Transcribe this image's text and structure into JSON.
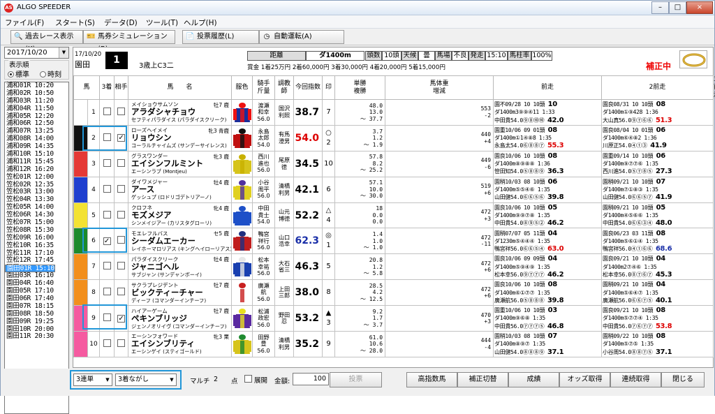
{
  "app": {
    "title": "ALGO SPEEDER",
    "logo_text": "AS"
  },
  "window_controls": {
    "min": "–",
    "max": "□",
    "close": "×"
  },
  "menu": [
    {
      "label": "ファイル(F)"
    },
    {
      "label": "スタート(S)"
    },
    {
      "label": "データ(D)"
    },
    {
      "label": "ツール(T)"
    },
    {
      "label": "ヘルプ(H)"
    }
  ],
  "toolbar": [
    {
      "label": "過去レース表示(K)",
      "icon": "search-icon",
      "glyph": "🔍"
    },
    {
      "label": "馬券シミュレーション(B)",
      "icon": "ticket-icon",
      "glyph": "🎫"
    },
    {
      "label": "投票履歴(L)",
      "icon": "document-icon",
      "glyph": "📄"
    },
    {
      "label": "自動運転(A)",
      "icon": "clock-icon",
      "glyph": "◷"
    }
  ],
  "sidebar": {
    "date": "2017/10/20",
    "order_label": "表示順",
    "order_opts": [
      "標準",
      "時刻"
    ],
    "order_selected": 0,
    "races": [
      "浦和01R 10:20",
      "浦和02R 10:50",
      "浦和03R 11:20",
      "浦和04R 11:50",
      "浦和05R 12:20",
      "浦和06R 12:50",
      "浦和07R 13:25",
      "浦和08R 14:00",
      "浦和09R 14:35",
      "浦和10R 15:10",
      "浦和11R 15:45",
      "浦和12R 16:20",
      "笠松01R 12:00",
      "笠松02R 12:35",
      "笠松03R 13:00",
      "笠松04R 13:30",
      "笠松05R 14:00",
      "笠松06R 14:30",
      "笠松07R 15:00",
      "笠松08R 15:30",
      "笠松09R 16:00",
      "笠松10R 16:35",
      "笠松11R 17:10",
      "笠松12R 17:45",
      "園田01R 15:10",
      "園田02R 15:40",
      "園田03R 16:10",
      "園田04R 16:40",
      "園田05R 17:10",
      "園田06R 17:40",
      "園田07R 18:15",
      "園田08R 18:50",
      "園田09R 19:25",
      "園田10R 20:00",
      "園田11R 20:30"
    ],
    "selected_race": 24
  },
  "race": {
    "date": "17/10/20",
    "venue": "園田",
    "number": "1",
    "class": "3歳上C3二",
    "dist_label": "距離",
    "dist": "ダ1400m",
    "heads_label": "頭数",
    "heads": "10頭",
    "weather_label": "天候",
    "weather": "曇",
    "track_label": "馬場",
    "track": "不良",
    "post_label": "発走",
    "post": "15:10",
    "horse_rate_label": "馬柱率",
    "horse_rate": "100%",
    "prize": "賞金 1着25万円 2着60,000円 3着30,000円 4着20,000円 5着15,000円",
    "hosei": "補正中"
  },
  "columns": [
    "馬",
    "3着",
    "相手",
    "馬　　名",
    "服色",
    "騎手\n斤量",
    "調教\n師",
    "今回指数",
    "印",
    "単勝\n複勝",
    "馬体重\n増減",
    "前走",
    "2前走",
    "3前走"
  ],
  "waku_colors": [
    "#ffffff",
    "#111111",
    "#e53935",
    "#1e3fcf",
    "#f3e233",
    "#1c8a2c",
    "#f28f1c",
    "#f55aa0"
  ],
  "horses": [
    {
      "waku": 1,
      "no": "1",
      "c3": false,
      "ai": false,
      "kana": "メイショウサムソン",
      "name": "アラダシャチョウ",
      "sire": "セフティパラダイス (パラダイスクリーク)",
      "tr": "牡7 鹿",
      "silk": [
        "#1a2d9a",
        "#e11",
        "#e11"
      ],
      "jockey": [
        "渡瀬",
        "和幸",
        "56.0"
      ],
      "trainer": [
        "国沢",
        "利照"
      ],
      "index": "38.7",
      "ic": "#000",
      "mark": "",
      "ninki": "7",
      "odds": [
        "48.0",
        "13.0",
        "～ 37.7"
      ],
      "wt": [
        "553",
        "-2"
      ],
      "p1": [
        "園不09/28  10 10頭 10",
        "ダ1400m3⑨⑨④11 1:33",
        "中田貴54.0⑨⑧⑩⑩ 42.0"
      ],
      "p2": [
        "園良08/31  10 10頭 08",
        "ダ1400m①⑨428 1:36",
        "大山真56.0⑨⑦⑥⑥ 51.3"
      ],
      "p3": [
        "園良08/03  10 10頭 08",
        "ダ1400m⑤⑨④⑧①0 1:35",
        "小谷周56.0⑨⑨⑨⑨ 41.3"
      ]
    },
    {
      "waku": 2,
      "no": "2",
      "c3": false,
      "ai": true,
      "kana": "ローズヘイメイ",
      "name": "リョウシン",
      "sire": "コーラルチャイムズ (サンデーサイレンス)",
      "tr": "牝3 青鹿",
      "silk": [
        "#c01010",
        "#111",
        "#c01010"
      ],
      "jockey": [
        "永島",
        "太郎",
        "54.0"
      ],
      "trainer": [
        "有馬",
        "澄男"
      ],
      "index": "54.0",
      "ic": "#d00",
      "mark": "○",
      "ninki": "2",
      "odds": [
        "3.7",
        "1.2",
        "～ 1.9"
      ],
      "wt": [
        "440",
        "+4"
      ],
      "p1": [
        "園重10/06  09 01頭 08",
        "ダ1400m①1④⑧8 1:35",
        "永島太54.0⑥⑧⑧⑦ 55.3"
      ],
      "p2": [
        "園良08/04  10 01頭 06",
        "ダ1400m⑥④⑧2 1:36",
        "川原正54.0④①③ 41.9"
      ],
      "p3": [
        "園良07/20  10 08頭 03",
        "ダ1400m⑥④⑧③ 1:36",
        "川原正54.0⑥⑥②③ 54.6"
      ]
    },
    {
      "waku": 3,
      "no": "3",
      "c3": false,
      "ai": false,
      "kana": "グラスワンダー",
      "name": "エイシンフルミント",
      "sire": "エーシンラブ (Montjeu)",
      "tr": "牝3 鹿",
      "silk": [
        "#d6c41c",
        "#c8b000",
        "#d6c41c"
      ],
      "jockey": [
        "西川",
        "進也",
        "56.0"
      ],
      "trainer": [
        "尾原",
        "徳"
      ],
      "index": "34.5",
      "ic": "#000",
      "mark": "",
      "ninki": "10",
      "odds": [
        "57.8",
        "8.2",
        "～ 25.2"
      ],
      "wt": [
        "449",
        "-6"
      ],
      "p1": [
        "園良10/06  10 10頭 08",
        "ダ1400m⑧⑨⑧⑧ 1:36",
        "笹田知54.0⑤⑧⑧⑨ 36.3"
      ],
      "p2": [
        "園重09/14  10 10頭 06",
        "ダ1400m⑨⑦⑦⑥ 1:35",
        "西川進54.0⑤⑦⑧⑤ 27.3"
      ],
      "p3": [
        "園良08/31  10 10頭 05",
        "ダ1400m②④③ 1:35",
        "笹田知54.0⑥⑥⑥⑤ 41.3"
      ]
    },
    {
      "waku": 4,
      "no": "4",
      "c3": false,
      "ai": false,
      "kana": "ダイワメジャー",
      "name": "アース",
      "sire": "ゲッシュプ (ロドリゴデトリアーノ)",
      "tr": "牡4 鹿",
      "silk": [
        "#e0d020",
        "#5030a0",
        "#e0d020"
      ],
      "jockey": [
        "小谷",
        "周平",
        "56.0"
      ],
      "trainer": [
        "清橋",
        "利男"
      ],
      "index": "42.1",
      "ic": "#000",
      "mark": "",
      "ninki": "6",
      "odds": [
        "57.1",
        "10.0",
        "～ 30.0"
      ],
      "wt": [
        "519",
        "+6"
      ],
      "p1": [
        "園稍10/03  08 10頭 06",
        "ダ1400m⑤⑤④⑥ 1:35",
        "山田健54.0⑥⑥⑤⑥ 39.8"
      ],
      "p2": [
        "園稍09/21  10 10頭 07",
        "ダ1400m⑦①⑧③ 1:35",
        "山田健54.0⑥⑥⑤⑦ 41.9"
      ],
      "p3": [
        "園良09/06  10 10頭 07",
        "ダ1400m⑥⑥⑤ 1:35",
        "山田健54.0⑤⑦⑥⑤ 41.9"
      ]
    },
    {
      "waku": 5,
      "no": "5",
      "c3": false,
      "ai": false,
      "kana": "クロフネ",
      "name": "モズメジア",
      "sire": "シンメイジアー (カリスタグローリ)",
      "tr": "牝4 鹿",
      "silk": [
        "#1e50c8",
        "#1e50c8",
        "#1e50c8"
      ],
      "jockey": [
        "中田",
        "貴士",
        "54.0"
      ],
      "trainer": [
        "山元",
        "博徳"
      ],
      "index": "52.2",
      "ic": "#000",
      "mark": "△",
      "ninki": "4",
      "odds": [
        "18",
        "0.0",
        "0.0"
      ],
      "wt": [
        "472",
        "+3"
      ],
      "p1": [
        "園良10/06  10 10頭 05",
        "ダ1400m⑨⑨⑦⑧ 1:35",
        "中田貴54.0⑧⑨⑤② 46.2"
      ],
      "p2": [
        "園稍09/21  10 10頭 05",
        "ダ1400m④⑤⑥⑥ 1:35",
        "中田貴54.0⑥⑥③④ 48.0"
      ],
      "p3": [
        "園良09/07  10 10頭 03",
        "ダ1400m⑤④⑤ 1:35",
        "中田貴54.0③⑦⑦① 53.8"
      ]
    },
    {
      "waku": 6,
      "no": "6",
      "c3": true,
      "ai": false,
      "kana": "モエレフルバス",
      "name": "シーダムエーカー",
      "sire": "レイホーマロリアス (キングヘイローリアス)",
      "tr": "セ5 鹿",
      "silk": [
        "#c01e1e",
        "#203080",
        "#c01e1e"
      ],
      "jockey": [
        "鴨宮",
        "祥行",
        "56.0"
      ],
      "trainer": [
        "山口",
        "浩幸"
      ],
      "index": "62.3",
      "ic": "#1a2fa8",
      "mark": "◎",
      "ninki": "1",
      "odds": [
        "1.4",
        "1.0",
        "～ 1.0"
      ],
      "wt": [
        "472",
        "-11"
      ],
      "p1": [
        "園稍07/07  05 11頭 04",
        "ダ1230m⑤④④④ 1:35",
        "鴨宮祥56.0⑥⑥⑤④ 63.0"
      ],
      "p2": [
        "園良06/23  03 11頭 08",
        "ダ1400m⑤⑥①④ 1:35",
        "鴨宮祥56.0④①⑥⑥ 68.6"
      ],
      "p3": [
        "園良06/08  10 10頭 06",
        "ダ1400m③⑥④⑥ 1:35",
        "鴨宮祥56.0③⑥⑥③ 66.5"
      ]
    },
    {
      "waku": 7,
      "no": "7",
      "c3": false,
      "ai": false,
      "kana": "パラダイスクリーク",
      "name": "ジャニゴヘル",
      "sire": "サブジャン (サンデャンボーイ)",
      "tr": "牡4 鹿",
      "silk": [
        "#1a40b0",
        "#e8e8e8",
        "#1a40b0"
      ],
      "jockey": [
        "松本",
        "幸祐",
        "56.0"
      ],
      "trainer": [
        "大石",
        "省三"
      ],
      "index": "46.3",
      "ic": "#000",
      "mark": "",
      "ninki": "5",
      "odds": [
        "20.8",
        "1.2",
        "～ 5.8"
      ],
      "wt": [
        "472",
        "+6"
      ],
      "p1": [
        "園良10/06  09 09頭 04",
        "ダ1400m⑤⑨④⑨ 1:35",
        "松本幸56.0⑨⑦⑦⑦ 46.2"
      ],
      "p2": [
        "園良09/21  10 10頭 04",
        "ダ1400m2⑦④⑥ 1:35",
        "松本幸56.0⑧⑦⑥⑦ 45.3"
      ],
      "p3": [
        "園稍08/24  10 10頭 04",
        "ダ1400m⑤⑥⑥ 1:35",
        "寺地続56.0⑧⑦⑦⑤ 41.9"
      ]
    },
    {
      "waku": 7,
      "no": "8",
      "c3": false,
      "ai": false,
      "kana": "サクラプレジデント",
      "name": "ビックティーチャー",
      "sire": "ディーフ (コマンダーインチーフ)",
      "tr": "牡7 鹿",
      "silk": [
        "#ffffff",
        "#c82020",
        "#ffffff"
      ],
      "jockey": [
        "廣瀬",
        "航",
        "56.0"
      ],
      "trainer": [
        "上田",
        "三郎"
      ],
      "index": "38.0",
      "ic": "#000",
      "mark": "",
      "ninki": "8",
      "odds": [
        "28.5",
        "4.2",
        "～ 12.5"
      ],
      "wt": [
        "472",
        "+6"
      ],
      "p1": [
        "園良10/06  10 10頭 08",
        "ダ1400m⑥①⑦⑦ 1:35",
        "廣瀬航56.0⑤⑧⑧⑧ 39.8"
      ],
      "p2": [
        "園稍09/21  10 10頭 04",
        "ダ1400m⑤⑥④⑦ 1:35",
        "廣瀬航56.0⑥⑥⑦⑤ 40.1"
      ],
      "p3": [
        "園良08/31  10 10頭 06",
        "ダ1400m⑦⑥⑤ 1:35",
        "廣瀬航56.0⑥⑥⑤⑤ 40.8"
      ]
    },
    {
      "waku": 8,
      "no": "9",
      "c3": false,
      "ai": true,
      "kana": "ハイアーゲーム",
      "name": "ペキンブリッジ",
      "sire": "ジェンノオリイヴ (コマンダーインチーフ)",
      "tr": "牡7 鹿",
      "silk": [
        "#5a2aa0",
        "#e8e020",
        "#5a2aa0"
      ],
      "jockey": [
        "松浦",
        "政宏",
        "56.0"
      ],
      "trainer": [
        "野田",
        "忍"
      ],
      "index": "53.2",
      "ic": "#000",
      "mark": "▲",
      "ninki": "3",
      "odds": [
        "9.2",
        "1.7",
        "～ 3.7"
      ],
      "wt": [
        "470",
        "+3"
      ],
      "p1": [
        "園重10/06  10 10頭 03",
        "ダ1400m⑨⑥⑧ 1:35",
        "中田貴56.0⑦⑦⑦⑤ 46.8"
      ],
      "p2": [
        "園良09/21  10 10頭 08",
        "ダ1400m⑤⑦⑦④ 1:35",
        "中田貴56.0⑦⑥⑦⑦ 53.8"
      ],
      "p3": [
        "園良09/07  10 10頭 03",
        "ダ1400m⑥④⑤ 1:35",
        "中田貴56.0⑦⑦⑧③ 54.6"
      ]
    },
    {
      "waku": 8,
      "no": "10",
      "c3": false,
      "ai": false,
      "kana": "エーシンフォワード",
      "name": "エイシンブリティ",
      "sire": "エーシンゲイ (スティゴールド)",
      "tr": "牝3 栗",
      "silk": [
        "#d6c41c",
        "#1e8a30",
        "#d6c41c"
      ],
      "jockey": [
        "田野",
        "豊",
        "56.0"
      ],
      "trainer": [
        "清橋",
        "利男"
      ],
      "index": "35.2",
      "ic": "#000",
      "mark": "",
      "ninki": "9",
      "odds": [
        "61.0",
        "10.6",
        "～ 28.0"
      ],
      "wt": [
        "444",
        "-4"
      ],
      "p1": [
        "園稍10/03  08 10頭 07",
        "ダ1400m⑧⑨⑦ 1:35",
        "山田健54.0⑧⑧⑧⑨ 37.1"
      ],
      "p2": [
        "園稍09/22  10 10頭 08",
        "ダ1400m⑤⑦⑤ 1:35",
        "小谷周54.0⑧⑧⑦⑤ 37.1"
      ],
      "p3": [
        "園良09/05  10 10頭 09",
        "ダ1400m④⑧⑦ 1:35",
        "小谷周56.0⑦⑧⑨⑨ 41.9"
      ]
    }
  ],
  "bottom": {
    "bet_type": "3連単",
    "bet_method": "3着ながし",
    "multi_label": "マルチ",
    "points": "2",
    "points_unit": "点",
    "expand_label": "展開",
    "amount_label": "金額:",
    "amount": "100",
    "amount_unit": "円",
    "vote": "投票",
    "buttons": [
      "高指数馬",
      "補正切替",
      "成績",
      "オッズ取得",
      "連続取得",
      "閉じる"
    ]
  }
}
